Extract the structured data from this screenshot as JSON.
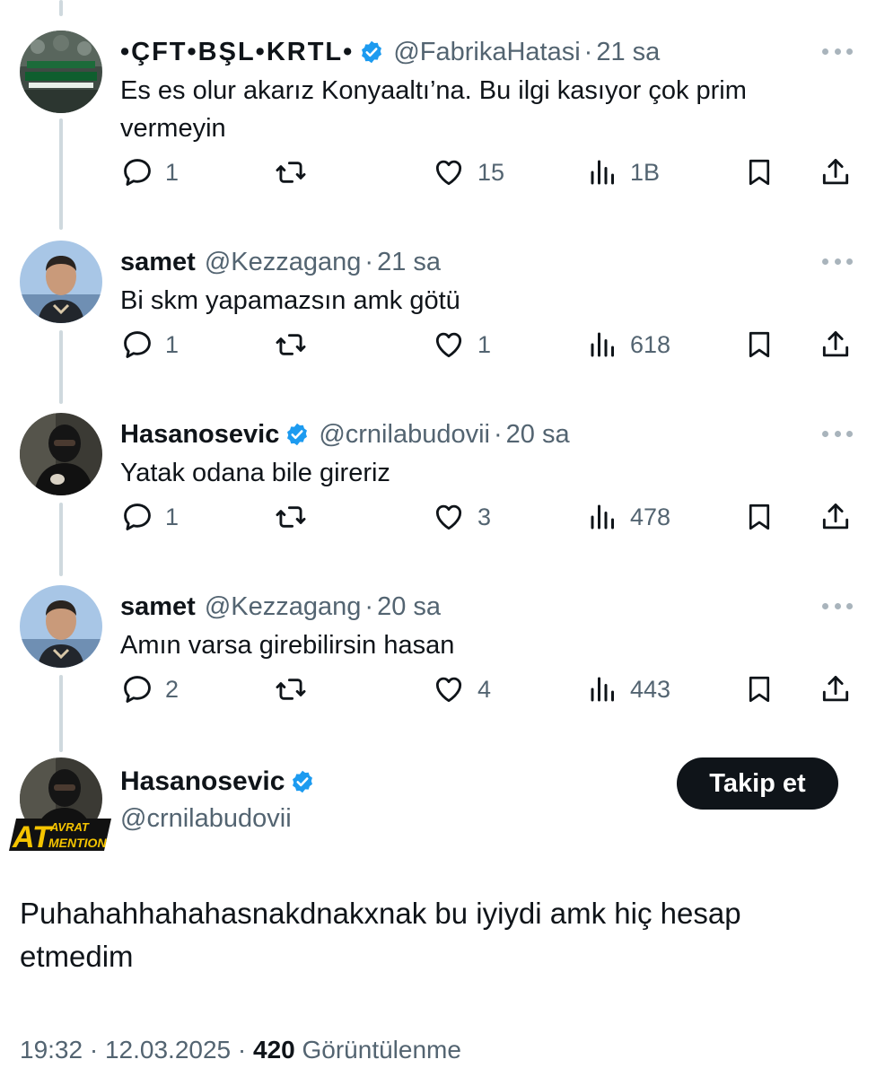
{
  "thread": [
    {
      "display_name": "•ÇFT•BŞL•KRTL•",
      "verified": true,
      "handle": "@FabrikaHatasi",
      "separator": "·",
      "time": "21 sa",
      "text": "Es es olur akarız Konyaaltı’na. Bu ilgi kasıyor çok prim vermeyin",
      "replies": "1",
      "reposts": "",
      "likes": "15",
      "views": "1B",
      "avatar": "konyaspor-fans-avatar"
    },
    {
      "display_name": "samet",
      "verified": false,
      "handle": "@Kezzagang",
      "separator": "·",
      "time": "21 sa",
      "text": "Bi skm yapamazsın amk götü",
      "replies": "1",
      "reposts": "",
      "likes": "1",
      "views": "618",
      "avatar": "selfie-avatar"
    },
    {
      "display_name": "Hasanosevic",
      "verified": true,
      "handle": "@crnilabudovii",
      "separator": "·",
      "time": "20 sa",
      "text": "Yatak odana bile gireriz",
      "replies": "1",
      "reposts": "",
      "likes": "3",
      "views": "478",
      "avatar": "masked-person-avatar"
    },
    {
      "display_name": "samet",
      "verified": false,
      "handle": "@Kezzagang",
      "separator": "·",
      "time": "20 sa",
      "text": "Amın varsa girebilirsin hasan",
      "replies": "2",
      "reposts": "",
      "likes": "4",
      "views": "443",
      "avatar": "selfie-avatar"
    }
  ],
  "main_tweet": {
    "display_name": "Hasanosevic",
    "verified": true,
    "handle": "@crnilabudovii",
    "follow_label": "Takip et",
    "badge_top": "AVRAT",
    "badge_left": "AT",
    "badge_bottom": "MENTION",
    "text": "Puhahahhahahasnakdnakxnak bu iyiydi amk hiç hesap etmedim",
    "time": "19:32",
    "separator": "·",
    "date": "12.03.2025",
    "separator2": "·",
    "views": "420",
    "views_label": "Görüntülenme"
  },
  "icons": [
    "reply-icon",
    "repost-icon",
    "like-icon",
    "views-icon",
    "bookmark-icon",
    "share-icon",
    "more-icon",
    "verified-badge-icon"
  ],
  "colors": {
    "text": "#0f1419",
    "secondary": "#536471",
    "verified": "#1d9bf0",
    "thread_line": "#cfd9de",
    "follow_bg": "#0f1419"
  }
}
